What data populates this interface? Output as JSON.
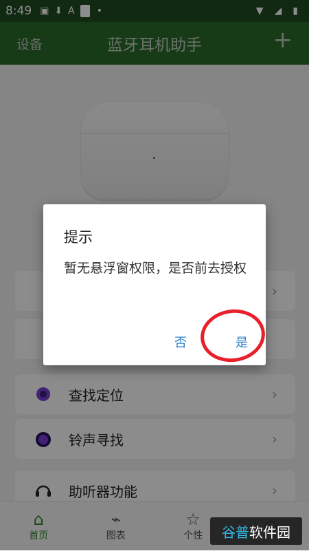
{
  "status_bar": {
    "time": "8:49"
  },
  "app_bar": {
    "left": "设备",
    "title": "蓝牙耳机助手",
    "plus": "+"
  },
  "cards": [
    {
      "label": "查找定位",
      "icon": "locate-icon"
    },
    {
      "label": "铃声寻找",
      "icon": "bell-icon"
    },
    {
      "label": "助听器功能",
      "icon": "headset-icon"
    }
  ],
  "tabs": [
    {
      "label": "首页",
      "icon": "home-icon"
    },
    {
      "label": "图表",
      "icon": "chart-icon"
    },
    {
      "label": "个性",
      "icon": "personal-icon"
    }
  ],
  "dialog": {
    "title": "提示",
    "message": "暂无悬浮窗权限，是否前去授权",
    "no": "否",
    "yes": "是"
  },
  "watermark": {
    "part1": "谷普",
    "part2": "软件园"
  },
  "colors": {
    "appbar": "#2b6b2b",
    "accent": "#2a7fc8",
    "highlight": "#e8202a"
  }
}
